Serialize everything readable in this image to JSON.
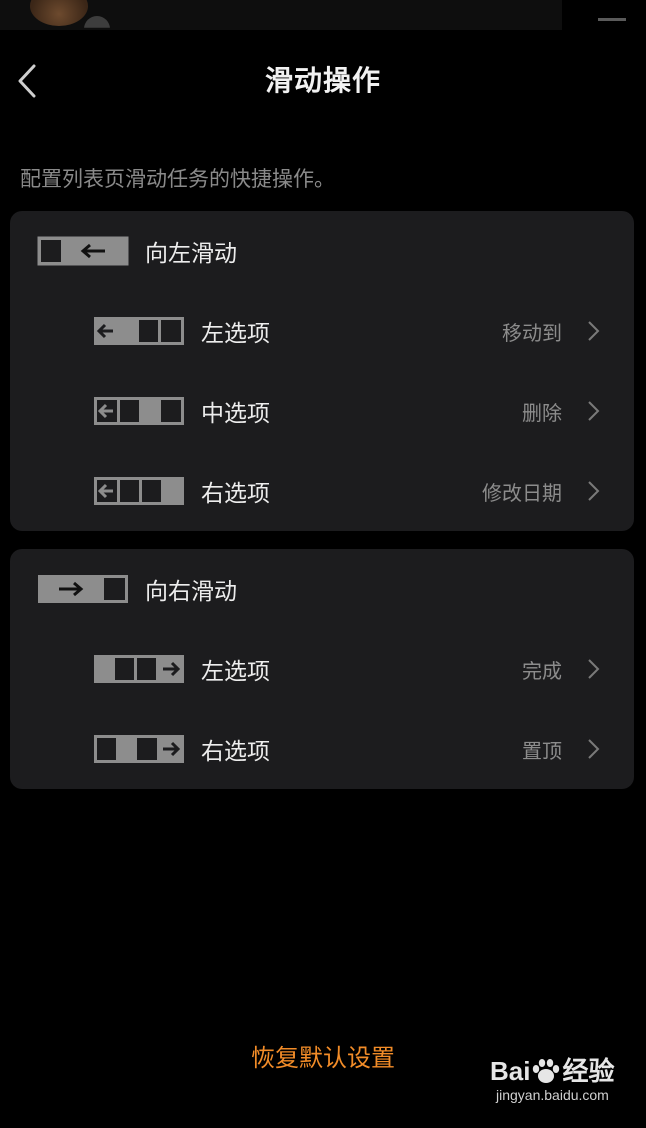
{
  "header": {
    "title": "滑动操作",
    "subtitle": "配置列表页滑动任务的快捷操作。"
  },
  "swipe_left": {
    "label": "向左滑动",
    "options": [
      {
        "label": "左选项",
        "value": "移动到"
      },
      {
        "label": "中选项",
        "value": "删除"
      },
      {
        "label": "右选项",
        "value": "修改日期"
      }
    ]
  },
  "swipe_right": {
    "label": "向右滑动",
    "options": [
      {
        "label": "左选项",
        "value": "完成"
      },
      {
        "label": "右选项",
        "value": "置顶"
      }
    ]
  },
  "footer": {
    "restore_label": "恢复默认设置"
  },
  "watermark": {
    "logo_left": "Bai",
    "logo_right": "经验",
    "url": "jingyan.baidu.com"
  },
  "icons": {
    "back": "chevron-left-icon",
    "row_chevron": "chevron-right-icon",
    "swipe_left": "swipe-left-icon",
    "swipe_right": "swipe-right-icon"
  },
  "colors": {
    "background": "#000000",
    "card": "#1c1c1e",
    "accent": "#f28c28",
    "secondary_text": "#8c8c8c",
    "glyph_fill": "#8d8d8d"
  }
}
